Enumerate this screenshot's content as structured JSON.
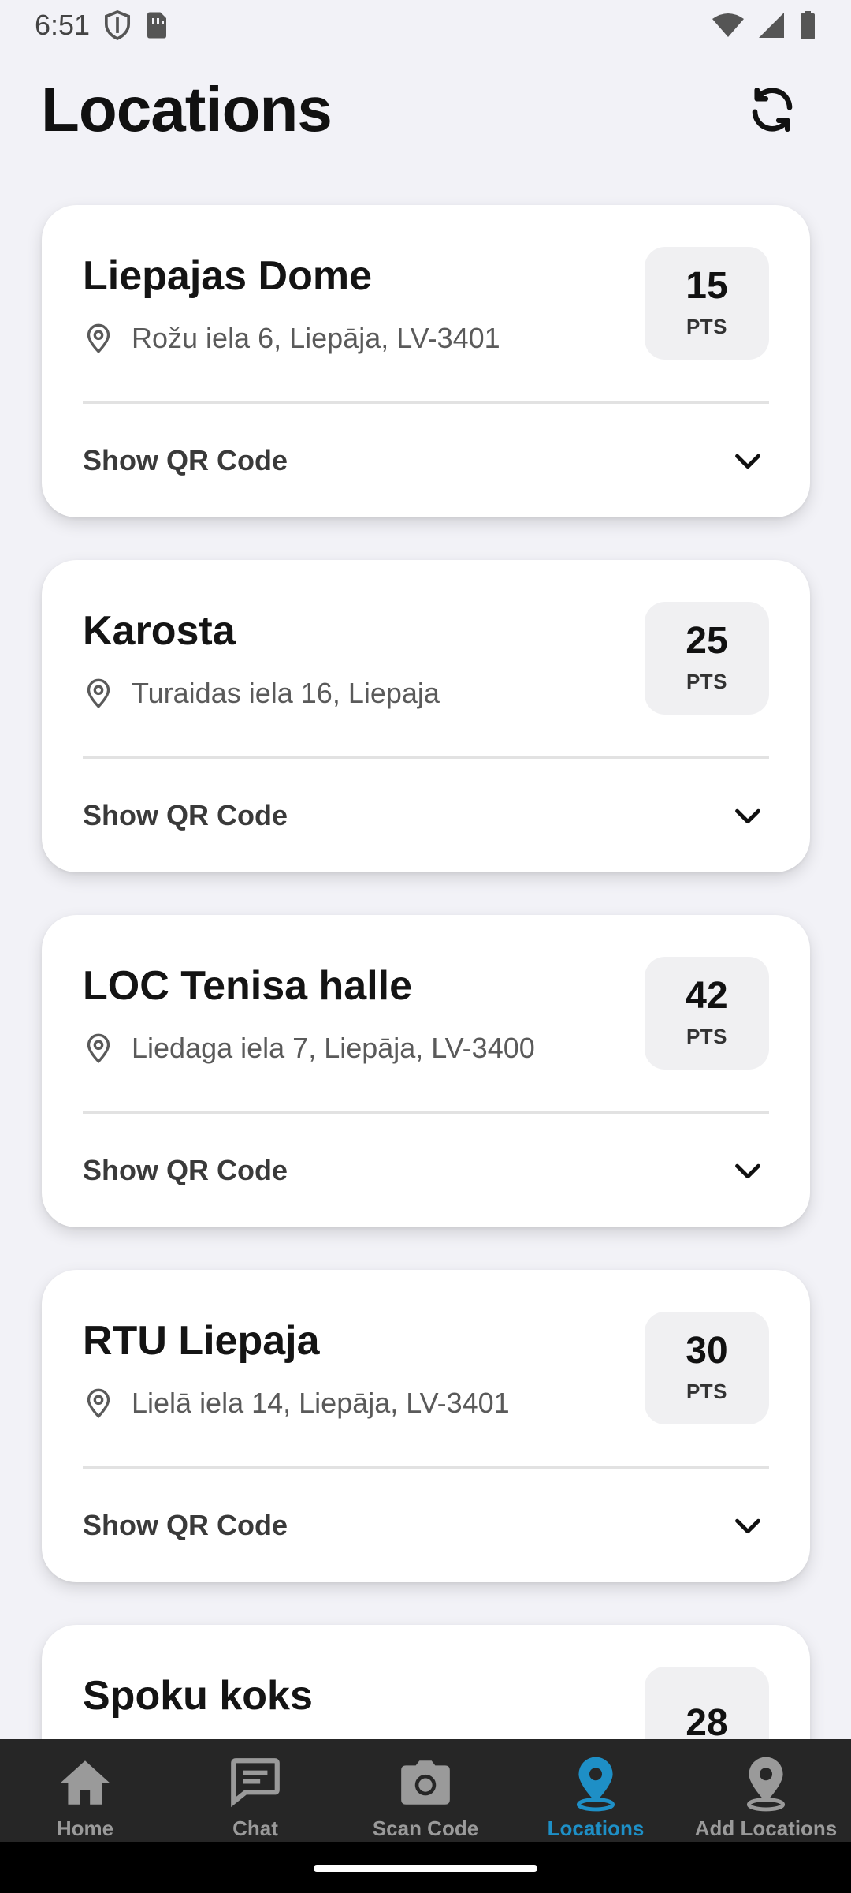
{
  "status_bar": {
    "time": "6:51",
    "icons_left": [
      "shield-icon",
      "sim-card-icon"
    ],
    "icons_right": [
      "wifi-icon",
      "signal-icon",
      "battery-icon"
    ]
  },
  "header": {
    "title": "Locations",
    "refresh_icon": "refresh-icon"
  },
  "locations": [
    {
      "name": "Liepajas Dome",
      "address": "Rožu iela 6, Liepāja, LV-3401",
      "points": "15",
      "points_unit": "PTS",
      "qr_label": "Show QR Code"
    },
    {
      "name": "Karosta",
      "address": "Turaidas iela 16, Liepaja",
      "points": "25",
      "points_unit": "PTS",
      "qr_label": "Show QR Code"
    },
    {
      "name": "LOC Tenisa halle",
      "address": "Liedaga iela 7, Liepāja, LV-3400",
      "points": "42",
      "points_unit": "PTS",
      "qr_label": "Show QR Code"
    },
    {
      "name": "RTU Liepaja",
      "address": "Lielā iela 14, Liepāja, LV-3401",
      "points": "30",
      "points_unit": "PTS",
      "qr_label": "Show QR Code"
    },
    {
      "name": "Spoku koks",
      "points": "28"
    }
  ],
  "bottom_nav": {
    "items": [
      {
        "label": "Home",
        "icon": "home-icon",
        "active": false
      },
      {
        "label": "Chat",
        "icon": "chat-icon",
        "active": false
      },
      {
        "label": "Scan Code",
        "icon": "camera-icon",
        "active": false
      },
      {
        "label": "Locations",
        "icon": "location-pin-icon",
        "active": true
      },
      {
        "label": "Add Locations",
        "icon": "add-location-icon",
        "active": false
      }
    ]
  },
  "colors": {
    "background": "#f2f2f7",
    "card": "#ffffff",
    "nav_background": "#262626",
    "nav_active": "#1e8fc6",
    "nav_inactive": "#9a9a9a"
  }
}
